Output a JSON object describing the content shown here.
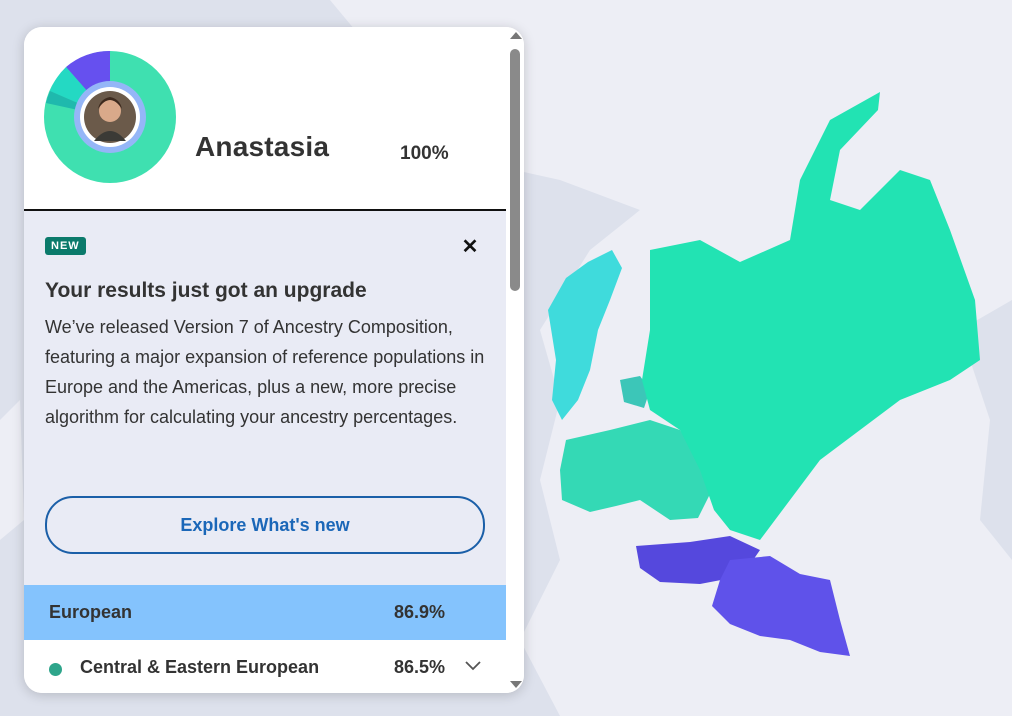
{
  "profile": {
    "name": "Anastasia",
    "percent": "100%"
  },
  "promo": {
    "badge": "NEW",
    "close_icon": "close-icon",
    "title": "Your results just got an upgrade",
    "body": "We’ve released Version 7 of Ancestry Composition, featuring a major expansion of reference populations in Europe and the Americas, plus a new, more precise algorithm for calculating your ancestry percentages.",
    "cta_label": "Explore What's new"
  },
  "ancestry": {
    "section": {
      "label": "European",
      "percent": "86.9%"
    },
    "items": [
      {
        "label": "Central & Eastern European",
        "percent": "86.5%",
        "color": "#2ea58b",
        "icon": "chevron-down-icon"
      }
    ]
  },
  "colors": {
    "primary_green": "#2ee6b8",
    "purple": "#5b4ee6",
    "section_blue": "#84c3fd",
    "cta_blue": "#1b67b8",
    "badge_teal": "#0b7a6b"
  }
}
